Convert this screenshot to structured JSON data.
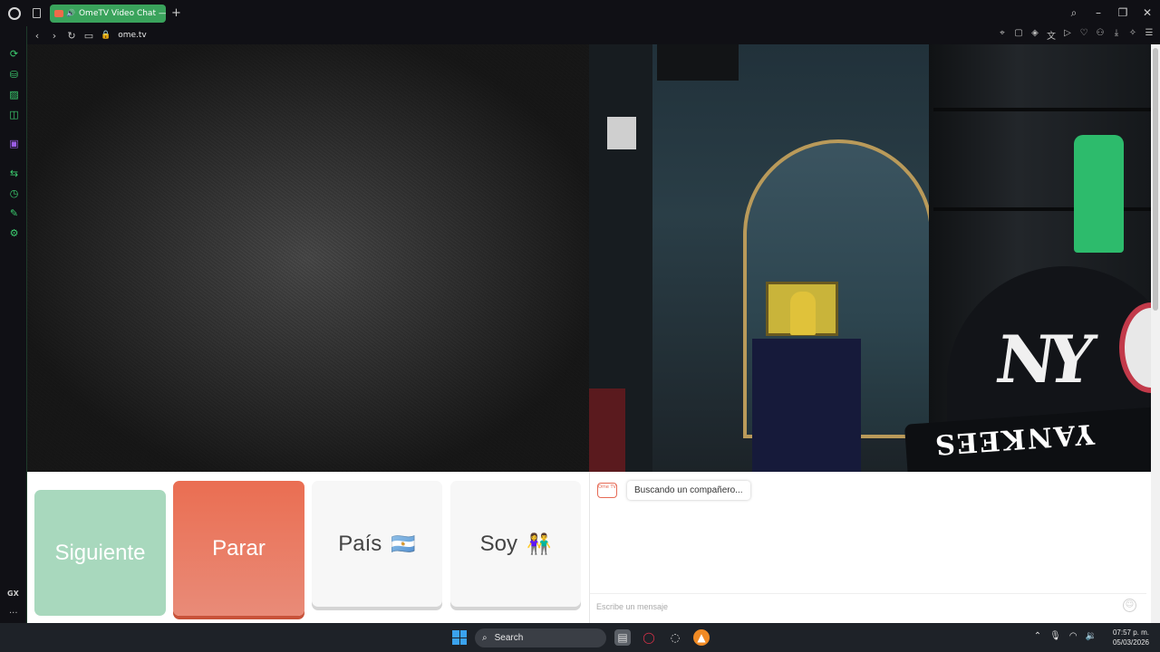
{
  "browser": {
    "tab_title": "OmeTV Video Chat —",
    "new_tab_icon": "plus-icon",
    "url": "ome.tv",
    "window_controls": [
      "search-icon",
      "minimize-icon",
      "restore-icon",
      "close-icon"
    ]
  },
  "panel": {
    "next_label": "Siguiente",
    "stop_label": "Parar",
    "country_label": "País",
    "country_flag": "🇦🇷",
    "gender_label": "Soy",
    "gender_emoji": "👫"
  },
  "chat": {
    "logo_text": "Ome TV",
    "status_message": "Buscando un compañero...",
    "input_placeholder": "Escribe un mensaje",
    "emoji_icon": "smiley-icon"
  },
  "video": {
    "cap_brand": "NY",
    "cap_brim_text": "YANKEES"
  },
  "sidebar": {
    "gx_label": "GX",
    "more_label": "..."
  },
  "taskbar": {
    "search_label": "Search",
    "time": "07:57 p. m.",
    "date": "05/03/2026"
  },
  "colors": {
    "next_button": "#a8d8bd",
    "stop_button": "#ea6e52",
    "accent_green": "#3aa35c"
  }
}
